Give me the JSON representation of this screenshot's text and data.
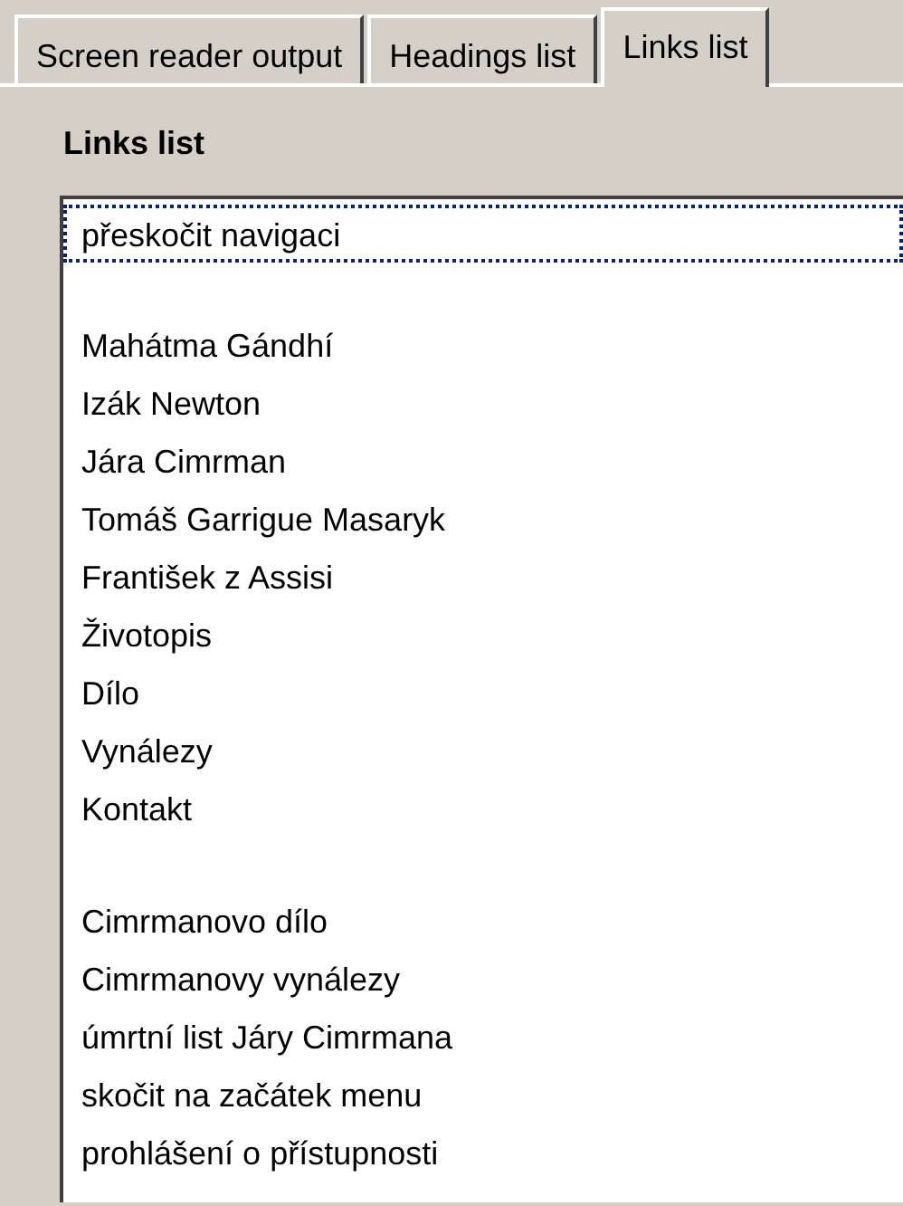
{
  "tabs": [
    {
      "label": "Screen reader output",
      "selected": false
    },
    {
      "label": "Headings list",
      "selected": false
    },
    {
      "label": "Links list",
      "selected": true
    }
  ],
  "panel": {
    "heading": "Links list"
  },
  "links": [
    {
      "items": [
        {
          "label": "přeskočit navigaci",
          "selected": true
        }
      ]
    },
    {
      "items": [
        {
          "label": "Mahátma Gándhí",
          "selected": false
        },
        {
          "label": "Izák Newton",
          "selected": false
        },
        {
          "label": "Jára Cimrman",
          "selected": false
        },
        {
          "label": "Tomáš Garrigue Masaryk",
          "selected": false
        },
        {
          "label": "František z Assisi",
          "selected": false
        },
        {
          "label": "Životopis",
          "selected": false
        },
        {
          "label": "Dílo",
          "selected": false
        },
        {
          "label": "Vynálezy",
          "selected": false
        },
        {
          "label": "Kontakt",
          "selected": false
        }
      ]
    },
    {
      "items": [
        {
          "label": "Cimrmanovo dílo",
          "selected": false
        },
        {
          "label": "Cimrmanovy vynálezy",
          "selected": false
        },
        {
          "label": "úmrtní list Járy Cimrmana",
          "selected": false
        },
        {
          "label": "skočit na začátek menu",
          "selected": false
        },
        {
          "label": "prohlášení o přístupnosti",
          "selected": false
        }
      ]
    }
  ]
}
